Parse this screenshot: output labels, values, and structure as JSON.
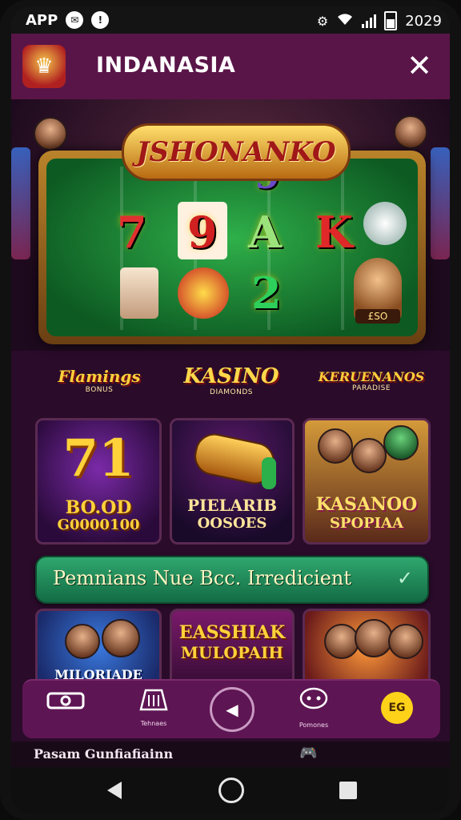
{
  "status_bar": {
    "app_label": "APP",
    "time": "2029",
    "icons": [
      "notification-icon",
      "alert-icon",
      "clock-icon",
      "wifi-icon",
      "signal-icon",
      "battery-icon"
    ]
  },
  "header": {
    "title": "INDANASIA",
    "logo_icon": "casino-logo-icon",
    "close_icon": "close-icon"
  },
  "hero": {
    "title": "JSHONANKO",
    "symbols": [
      "7",
      "9",
      "A",
      "K",
      "9",
      "2",
      "2"
    ],
    "machine_label": "£SO"
  },
  "brands": [
    {
      "main": "Flamings",
      "sub": "BONUS"
    },
    {
      "main": "KASINO",
      "sub": "DIAMONDS"
    },
    {
      "main": "KERUENANOS",
      "sub": "PARADISE"
    }
  ],
  "games_row1": [
    {
      "big": "71",
      "line1": "BO.OD",
      "line2": "G0000100"
    },
    {
      "line1": "PIELARIB",
      "line2": "OOSOES"
    },
    {
      "line1": "KASANOO",
      "line2": "SPOPIAA"
    }
  ],
  "promo_banner": {
    "text": "Pemnians Nue Bcc. Irredicient",
    "icon": "check-icon"
  },
  "games_row2": [
    {
      "line1": "MILORIADE"
    },
    {
      "line1": "EASSHIAK",
      "line2": "MULOPAIH"
    },
    {
      "line1": ""
    }
  ],
  "tabs": [
    {
      "label": "",
      "icon": "camera-icon"
    },
    {
      "label": "Tehnaes",
      "icon": "slot-machine-icon"
    },
    {
      "label": "",
      "icon": "play-icon"
    },
    {
      "label": "Pomones",
      "icon": "chat-icon"
    },
    {
      "label": "EG",
      "icon": "coin-icon"
    }
  ],
  "bottom_peek": {
    "text": "Pasam Gunfiafiainn",
    "icon": "gamepad-icon"
  },
  "nav": [
    "back-icon",
    "home-icon",
    "recents-icon"
  ],
  "colors": {
    "app_bg": "#2a0b2a",
    "header": "#5a1548",
    "accent_gold": "#ffcf3a",
    "banner_green": "#2fa76e",
    "tabbar": "#5e1553",
    "coin": "#ffd21a"
  }
}
